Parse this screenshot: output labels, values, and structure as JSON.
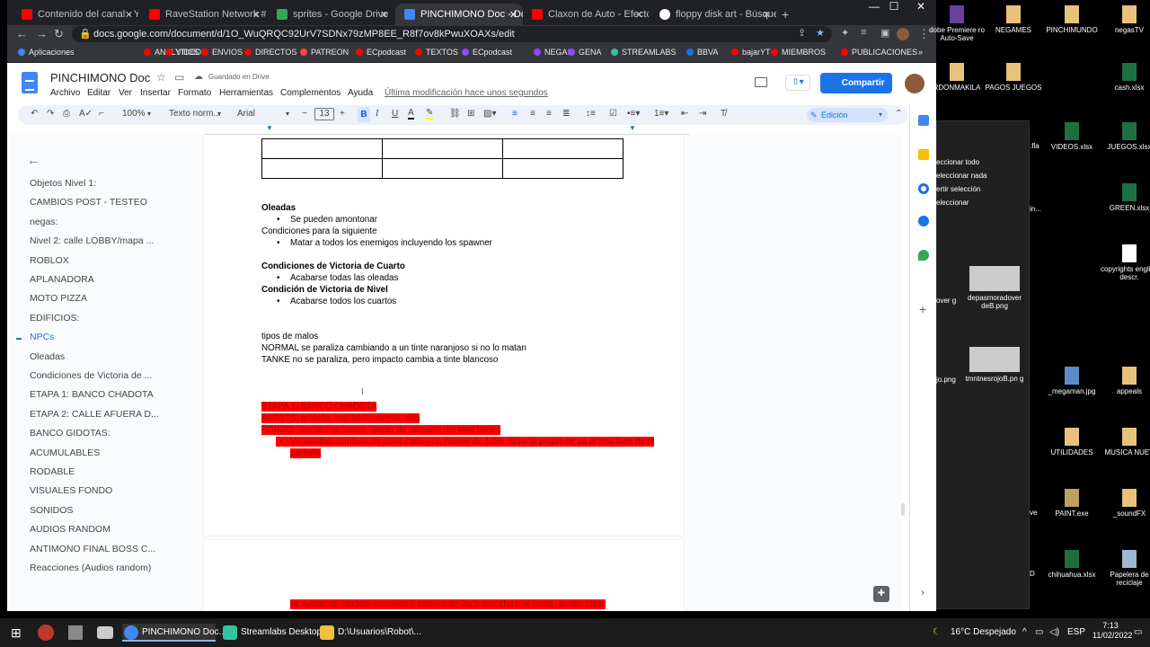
{
  "browser": {
    "tabs": [
      {
        "title": "Contenido del canal - YouTub",
        "color": "#ff0000"
      },
      {
        "title": "RaveStation Network #",
        "color": "#ff0000"
      },
      {
        "title": "sprites - Google Drive",
        "color": "#34a853"
      },
      {
        "title": "PINCHIMONO Doc - Docum",
        "color": "#4285f4"
      },
      {
        "title": "Claxon de Auto - Efecto de",
        "color": "#ff0000"
      },
      {
        "title": "floppy disk art - Búsqueda",
        "color": "#ffffff"
      }
    ],
    "new_tab": "+",
    "url": "docs.google.com/document/d/1O_WuQRQC92UrV7SDNx79zMP8EE_R8f7ov8kPwuXOAXs/edit",
    "bookmarks": [
      "Aplicaciones",
      "ANALYTICS",
      "VIDEOS",
      "ENVIOS",
      "DIRECTOS",
      "PATREON",
      "ECpodcast",
      "TEXTOS",
      "ECpodcast",
      "NEGAS",
      "GENA",
      "STREAMLABS",
      "BBVA",
      "bajarYT",
      "MIEMBROS",
      "PUBLICACIONES"
    ]
  },
  "docs": {
    "title": "PINCHIMONO Doc",
    "saved": "Guardado en Drive",
    "menu": [
      "Archivo",
      "Editar",
      "Ver",
      "Insertar",
      "Formato",
      "Herramientas",
      "Complementos",
      "Ayuda"
    ],
    "last_modified": "Última modificación hace unos segundos",
    "share": "Compartir",
    "toolbar": {
      "zoom": "100%",
      "style": "Texto norm...",
      "font": "Arial",
      "size": "13",
      "mode": "Edición"
    }
  },
  "outline": [
    "Objetos Nivel 1:",
    "CAMBIOS POST - TESTEO",
    "negas:",
    "Nivel 2: calle LOBBY/mapa ...",
    "ROBLOX",
    "APLANADORA",
    "MOTO PIZZA",
    "EDIFICIOS:",
    "NPCs",
    "Oleadas",
    "Condiciones de Victoria de ...",
    "ETAPA 1: BANCO CHADOTA",
    "ETAPA 2: CALLE AFUERA D...",
    "BANCO GIDOTAS:",
    "ACUMULABLES",
    "RODABLE",
    "VISUALES FONDO",
    "SONIDOS",
    "AUDIOS RANDOM",
    "ANTIMONO FINAL BOSS C...",
    "Reacciones (Audios random)"
  ],
  "content": {
    "oleadas_head": "Oleadas",
    "oleadas_b1": "Se pueden amontonar",
    "cond_next": "Condiciones para la siguiente",
    "cond_b1": "Matar a todos los enemigos incluyendo los spawner",
    "victoria_cuarto": "Condiciones de Victoria de Cuarto",
    "victoria_cuarto_b1": "Acabarse todas las oleadas",
    "victoria_nivel": "Condición de Victoria de Nivel",
    "victoria_nivel_b1": "Acabarse todos los cuartos",
    "tipos": "tipos de malos",
    "normal": "NORMAL se paraliza cambiando a un tinte naranjoso si no lo matan",
    "tanke": "TANKE no se paraliza, pero impacto cambia a tinte blancoso",
    "etapa1": "ETAPA 1: BANCO CHADOTA",
    "assets": "ASSETS: maceta, escritorio, dinero, silla",
    "fondo": "FONDO: ventanillas banco, lineas de mosaico del piso banco",
    "bullet_red": "Ventanillas cambian de color cada vez, muere de 1 tiro, si no le pegas se va al otro lado de la",
    "bullet_red2": "pantalla",
    "page2_red": "se aparecen random efectivos y camina de izq a derecha o al reves, puede tocar"
  },
  "desktop": {
    "icons": [
      {
        "label": "dobe Premiere ro Auto-Save",
        "color": "#6b3fa0"
      },
      {
        "label": "NEGAMES",
        "color": "#e8c27a"
      },
      {
        "label": "PINCHIMUNDO",
        "color": "#e8c27a"
      },
      {
        "label": "negasTV",
        "color": "#e8c27a"
      },
      {
        "label": "RDONMAKILA",
        "color": "#e8c27a"
      },
      {
        "label": "PAGOS JUEGOS",
        "color": "#e8c27a"
      },
      {
        "label": "cash.xlsx",
        "color": "#1d6f42"
      },
      {
        "label": "VIDEOS.xlsx",
        "color": "#1d6f42"
      },
      {
        "label": "JUEGOS.xlsx",
        "color": "#1d6f42"
      },
      {
        "label": "GREEN.xlsx",
        "color": "#1d6f42"
      },
      {
        "label": "copyrights english descr.",
        "color": "#ffffff"
      },
      {
        "label": "depasmoradover deB.png",
        "color": "#cccccc"
      },
      {
        "label": "tmntnesrojoB.pn g",
        "color": "#cccccc"
      },
      {
        "label": "_megaman.jpg",
        "color": "#5b8cc9"
      },
      {
        "label": "appeals",
        "color": "#e8c27a"
      },
      {
        "label": "UTILIDADES",
        "color": "#e8c27a"
      },
      {
        "label": "MUSICA NUEV",
        "color": "#e8c27a"
      },
      {
        "label": "PAINT.exe",
        "color": "#c0a060"
      },
      {
        "label": "_soundFX",
        "color": "#e8c27a"
      },
      {
        "label": "chihuahua.xlsx",
        "color": "#1d6f42"
      },
      {
        "label": "Papelera de reciclaje",
        "color": "#9fb7d0"
      }
    ],
    "context_menu": [
      "eccionar todo",
      "eleccionar nada",
      "ertir selección",
      "eleccionar"
    ],
    "partial": [
      ".fla",
      "in...",
      "over g",
      "jo.png",
      "ve",
      "D"
    ]
  },
  "taskbar": {
    "apps": [
      {
        "label": "PINCHIMONO Doc...",
        "color": "#4285f4"
      },
      {
        "label": "Streamlabs Desktop",
        "color": "#31c3a2"
      },
      {
        "label": "D:\\Usuarios\\Robot\\...",
        "color": "#f0c040"
      }
    ],
    "weather": "16°C  Despejado",
    "lang": "ESP",
    "time": "7:13",
    "date": "11/02/2022"
  }
}
